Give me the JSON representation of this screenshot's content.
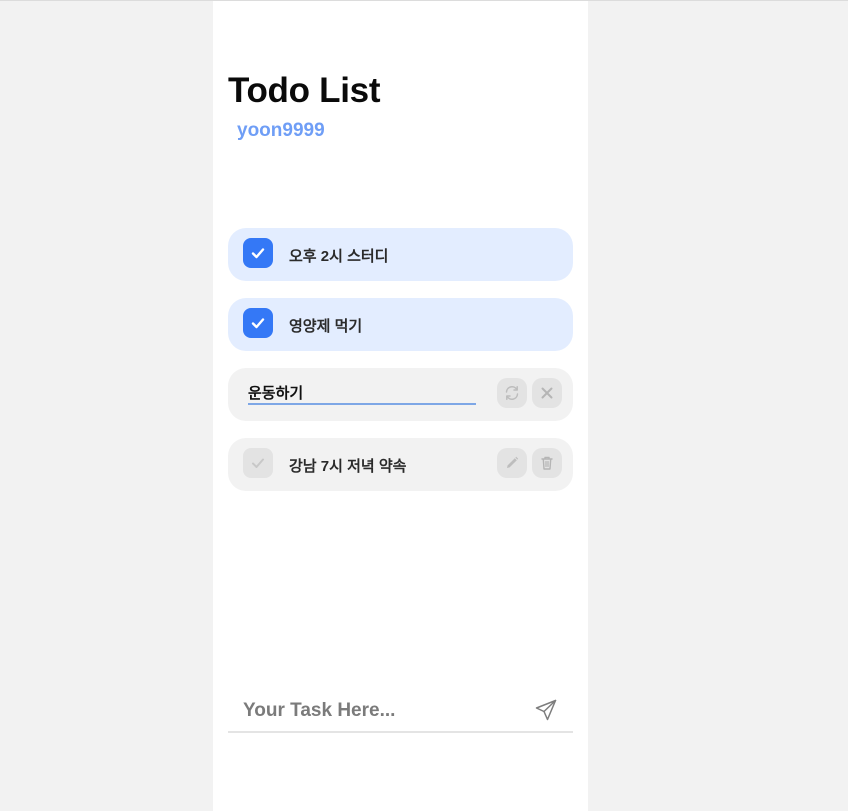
{
  "app": {
    "title": "Todo List",
    "user": "yoon9999"
  },
  "todos": [
    {
      "label": "오후 2시 스터디",
      "completed": true
    },
    {
      "label": "영양제 먹기",
      "completed": true
    },
    {
      "label": "운동하기",
      "completed": false,
      "editing": true
    },
    {
      "label": "강남 7시 저녁 약속",
      "completed": false
    }
  ],
  "icons": {
    "check": "check-icon",
    "refresh": "refresh-icon",
    "close": "close-icon",
    "edit": "pencil-icon",
    "delete": "trash-icon",
    "send": "send-icon"
  },
  "input": {
    "placeholder": "Your Task Here...",
    "value": ""
  },
  "colors": {
    "accent": "#3478f6",
    "user": "#6f9ef6",
    "done_bg": "#e3edff",
    "todo_bg": "#f2f2f2"
  }
}
